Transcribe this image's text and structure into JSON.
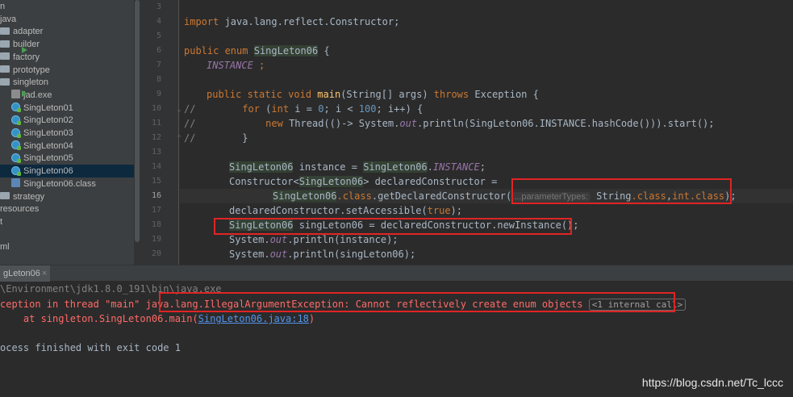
{
  "sidebar": {
    "items": [
      {
        "label": "n",
        "icon": "none"
      },
      {
        "label": "java",
        "icon": "none"
      },
      {
        "label": "adapter",
        "icon": "folder-icon"
      },
      {
        "label": "builder",
        "icon": "folder-icon"
      },
      {
        "label": "factory",
        "icon": "folder-icon"
      },
      {
        "label": "prototype",
        "icon": "folder-icon"
      },
      {
        "label": "singleton",
        "icon": "folder-icon"
      },
      {
        "label": "jad.exe",
        "icon": "exe-file-icon"
      },
      {
        "label": "SingLeton01",
        "icon": "java-class-icon"
      },
      {
        "label": "SingLeton02",
        "icon": "java-class-icon"
      },
      {
        "label": "SingLeton03",
        "icon": "java-class-icon"
      },
      {
        "label": "SingLeton04",
        "icon": "java-class-icon"
      },
      {
        "label": "SingLeton05",
        "icon": "java-class-icon"
      },
      {
        "label": "SingLeton06",
        "icon": "java-class-icon",
        "selected": true
      },
      {
        "label": "SingLeton06.class",
        "icon": "class-file-icon"
      },
      {
        "label": "strategy",
        "icon": "folder-icon"
      },
      {
        "label": "resources",
        "icon": "none"
      },
      {
        "label": "t",
        "icon": "none"
      },
      {
        "label": "",
        "icon": "none"
      },
      {
        "label": "ml",
        "icon": "none"
      }
    ]
  },
  "editor": {
    "line_numbers": [
      "3",
      "4",
      "5",
      "6",
      "7",
      "8",
      "9",
      "10",
      "11",
      "12",
      "13",
      "14",
      "15",
      "16",
      "17",
      "18",
      "19",
      "20"
    ],
    "current_line": "16",
    "code": {
      "l4_kw": "import",
      "l4_rest": " java.lang.reflect.Constructor;",
      "l6_kw": "public enum",
      "l6_name": "SingLeton06",
      "l6_rest": " {",
      "l7_const": "INSTANCE",
      "l7_rest": " ;",
      "l9_kw": "public static void",
      "l9_fn": "main",
      "l9_args": "(String[] args) ",
      "l9_throws": "throws",
      "l9_rest": " Exception {",
      "l10_cmt": "//",
      "l10_kw": "for",
      "l10_a": " (",
      "l10_int": "int",
      "l10_b": " i = ",
      "l10_n0": "0",
      "l10_c": "; i < ",
      "l10_n100": "100",
      "l10_d": "; i++) {",
      "l11_cmt": "//",
      "l11_kw": "new",
      "l11_a": " Thread(()-> System.",
      "l11_out": "out",
      "l11_b": ".println(",
      "l11_name": "SingLeton06",
      "l11_c": ".INSTANCE.hashCode())).start();",
      "l12_cmt": "//",
      "l12_rest": "}",
      "l14_type": "SingLeton06",
      "l14_a": " instance = ",
      "l14_name": "SingLeton06",
      "l14_dot": ".",
      "l14_const": "INSTANCE",
      "l14_end": ";",
      "l15_a": "Constructor<",
      "l15_type": "SingLeton06",
      "l15_b": "> declaredConstructor =",
      "l16_name": "SingLeton06",
      "l16_kw": ".class",
      "l16_a": ".getDeclaredConstructor(",
      "l16_hint": "...parameterTypes:",
      "l16_b": " String",
      "l16_kw2": ".class",
      "l16_c": ",",
      "l16_int": "int",
      "l16_kw3": ".class",
      "l16_d": ");",
      "l17_a": "declaredConstructor.setAccessible(",
      "l17_true": "true",
      "l17_b": ");",
      "l18_type": "SingLeton06",
      "l18_a": " singLeton06 = declaredConstructor.newInstance();",
      "l19_a": "System.",
      "l19_out": "out",
      "l19_b": ".println(instance);",
      "l20_a": "System.",
      "l20_out": "out",
      "l20_b": ".println(singLeton06);"
    }
  },
  "run_panel": {
    "tab_label": "gLeton06",
    "tab_close": "×",
    "line1": "\\Environment\\jdk1.8.0_191\\bin\\java.exe",
    "line2_a": "ception in thread \"main\" java.lang.IllegalArgumentException: Cannot reflectively create enum objects",
    "line2_internal": "<1 internal call>",
    "line3_a": "    at singleton.SingLeton06.main(",
    "line3_link": "SingLeton06.java:18",
    "line3_b": ")",
    "line4": "ocess finished with exit code 1"
  },
  "watermark": "https://blog.csdn.net/Tc_lccc",
  "colors": {
    "highlight_box": "#e02424",
    "error_text": "#ff6b68",
    "link": "#5394ec",
    "run_icon": "#499c54"
  }
}
